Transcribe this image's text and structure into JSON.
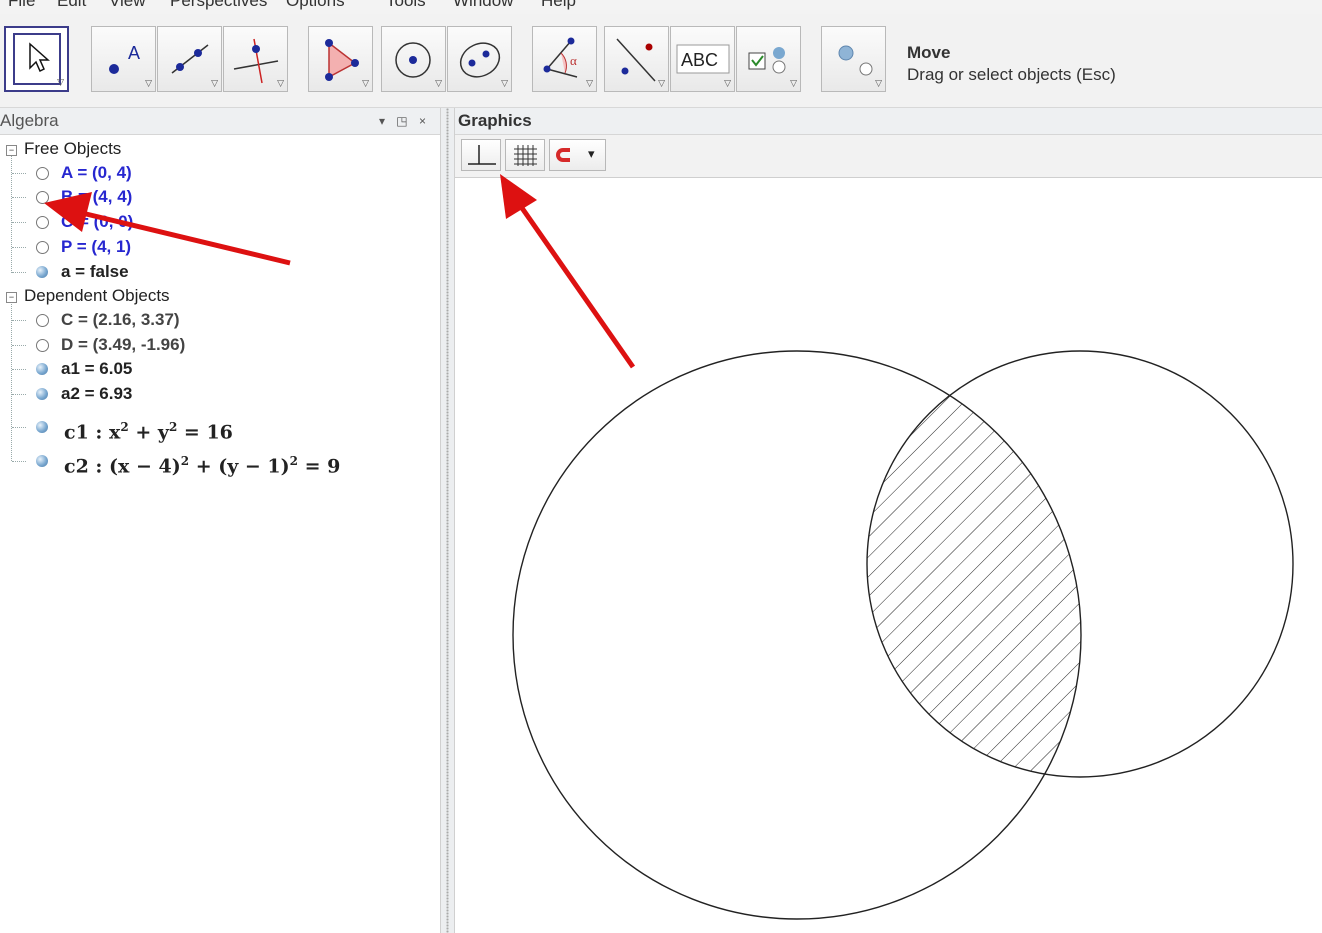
{
  "menu": [
    "File",
    "Edit",
    "View",
    "Perspectives",
    "Options",
    "Tools",
    "Window",
    "Help"
  ],
  "toolbar": {
    "tools": [
      {
        "name": "move-tool-button",
        "icon": "cursor-arrow-icon"
      },
      {
        "name": "point-tool-button",
        "icon": "point-A-icon"
      },
      {
        "name": "line-tool-button",
        "icon": "line-icon"
      },
      {
        "name": "perpendicular-tool-button",
        "icon": "perpendicular-line-icon"
      },
      {
        "name": "polygon-tool-button",
        "icon": "polygon-icon"
      },
      {
        "name": "circle-tool-button",
        "icon": "circle-center-point-icon"
      },
      {
        "name": "ellipse-tool-button",
        "icon": "ellipse-icon"
      },
      {
        "name": "angle-tool-button",
        "icon": "angle-icon"
      },
      {
        "name": "reflect-tool-button",
        "icon": "reflect-about-line-icon"
      },
      {
        "name": "text-tool-button",
        "icon": "abc-text-icon"
      },
      {
        "name": "checkbox-tool-button",
        "icon": "checkbox-icon"
      },
      {
        "name": "move-graphics-tool-button",
        "icon": "move-graphics-icon"
      }
    ],
    "text_tool_label": "ABC",
    "point_tool_label": "A",
    "angle_tool_label": "α",
    "help_title": "Move",
    "help_text": "Drag or select objects (Esc)"
  },
  "algebra": {
    "title": "Algebra",
    "controls": "▾ ◳ ×",
    "free_label": "Free Objects",
    "free": [
      "A = (0, 4)",
      "B = (4, 4)",
      "O = (0, 0)",
      "P = (4, 1)"
    ],
    "bool_item": "a = false",
    "dependent_label": "Dependent Objects",
    "dependent_points": [
      "C = (2.16, 3.37)",
      "D = (3.49, -1.96)"
    ],
    "dependent_numbers": [
      "a1 = 6.05",
      "a2 = 6.93"
    ],
    "c1_prefix": "c1 :",
    "c2_prefix": "c2 :"
  },
  "graphics": {
    "title": "Graphics",
    "dropdown_arrow": "▾"
  },
  "colors": {
    "annotation_arrow": "#dd1111",
    "free_object_text": "#2727d0",
    "selected_tool_border": "#3c3c8a"
  }
}
